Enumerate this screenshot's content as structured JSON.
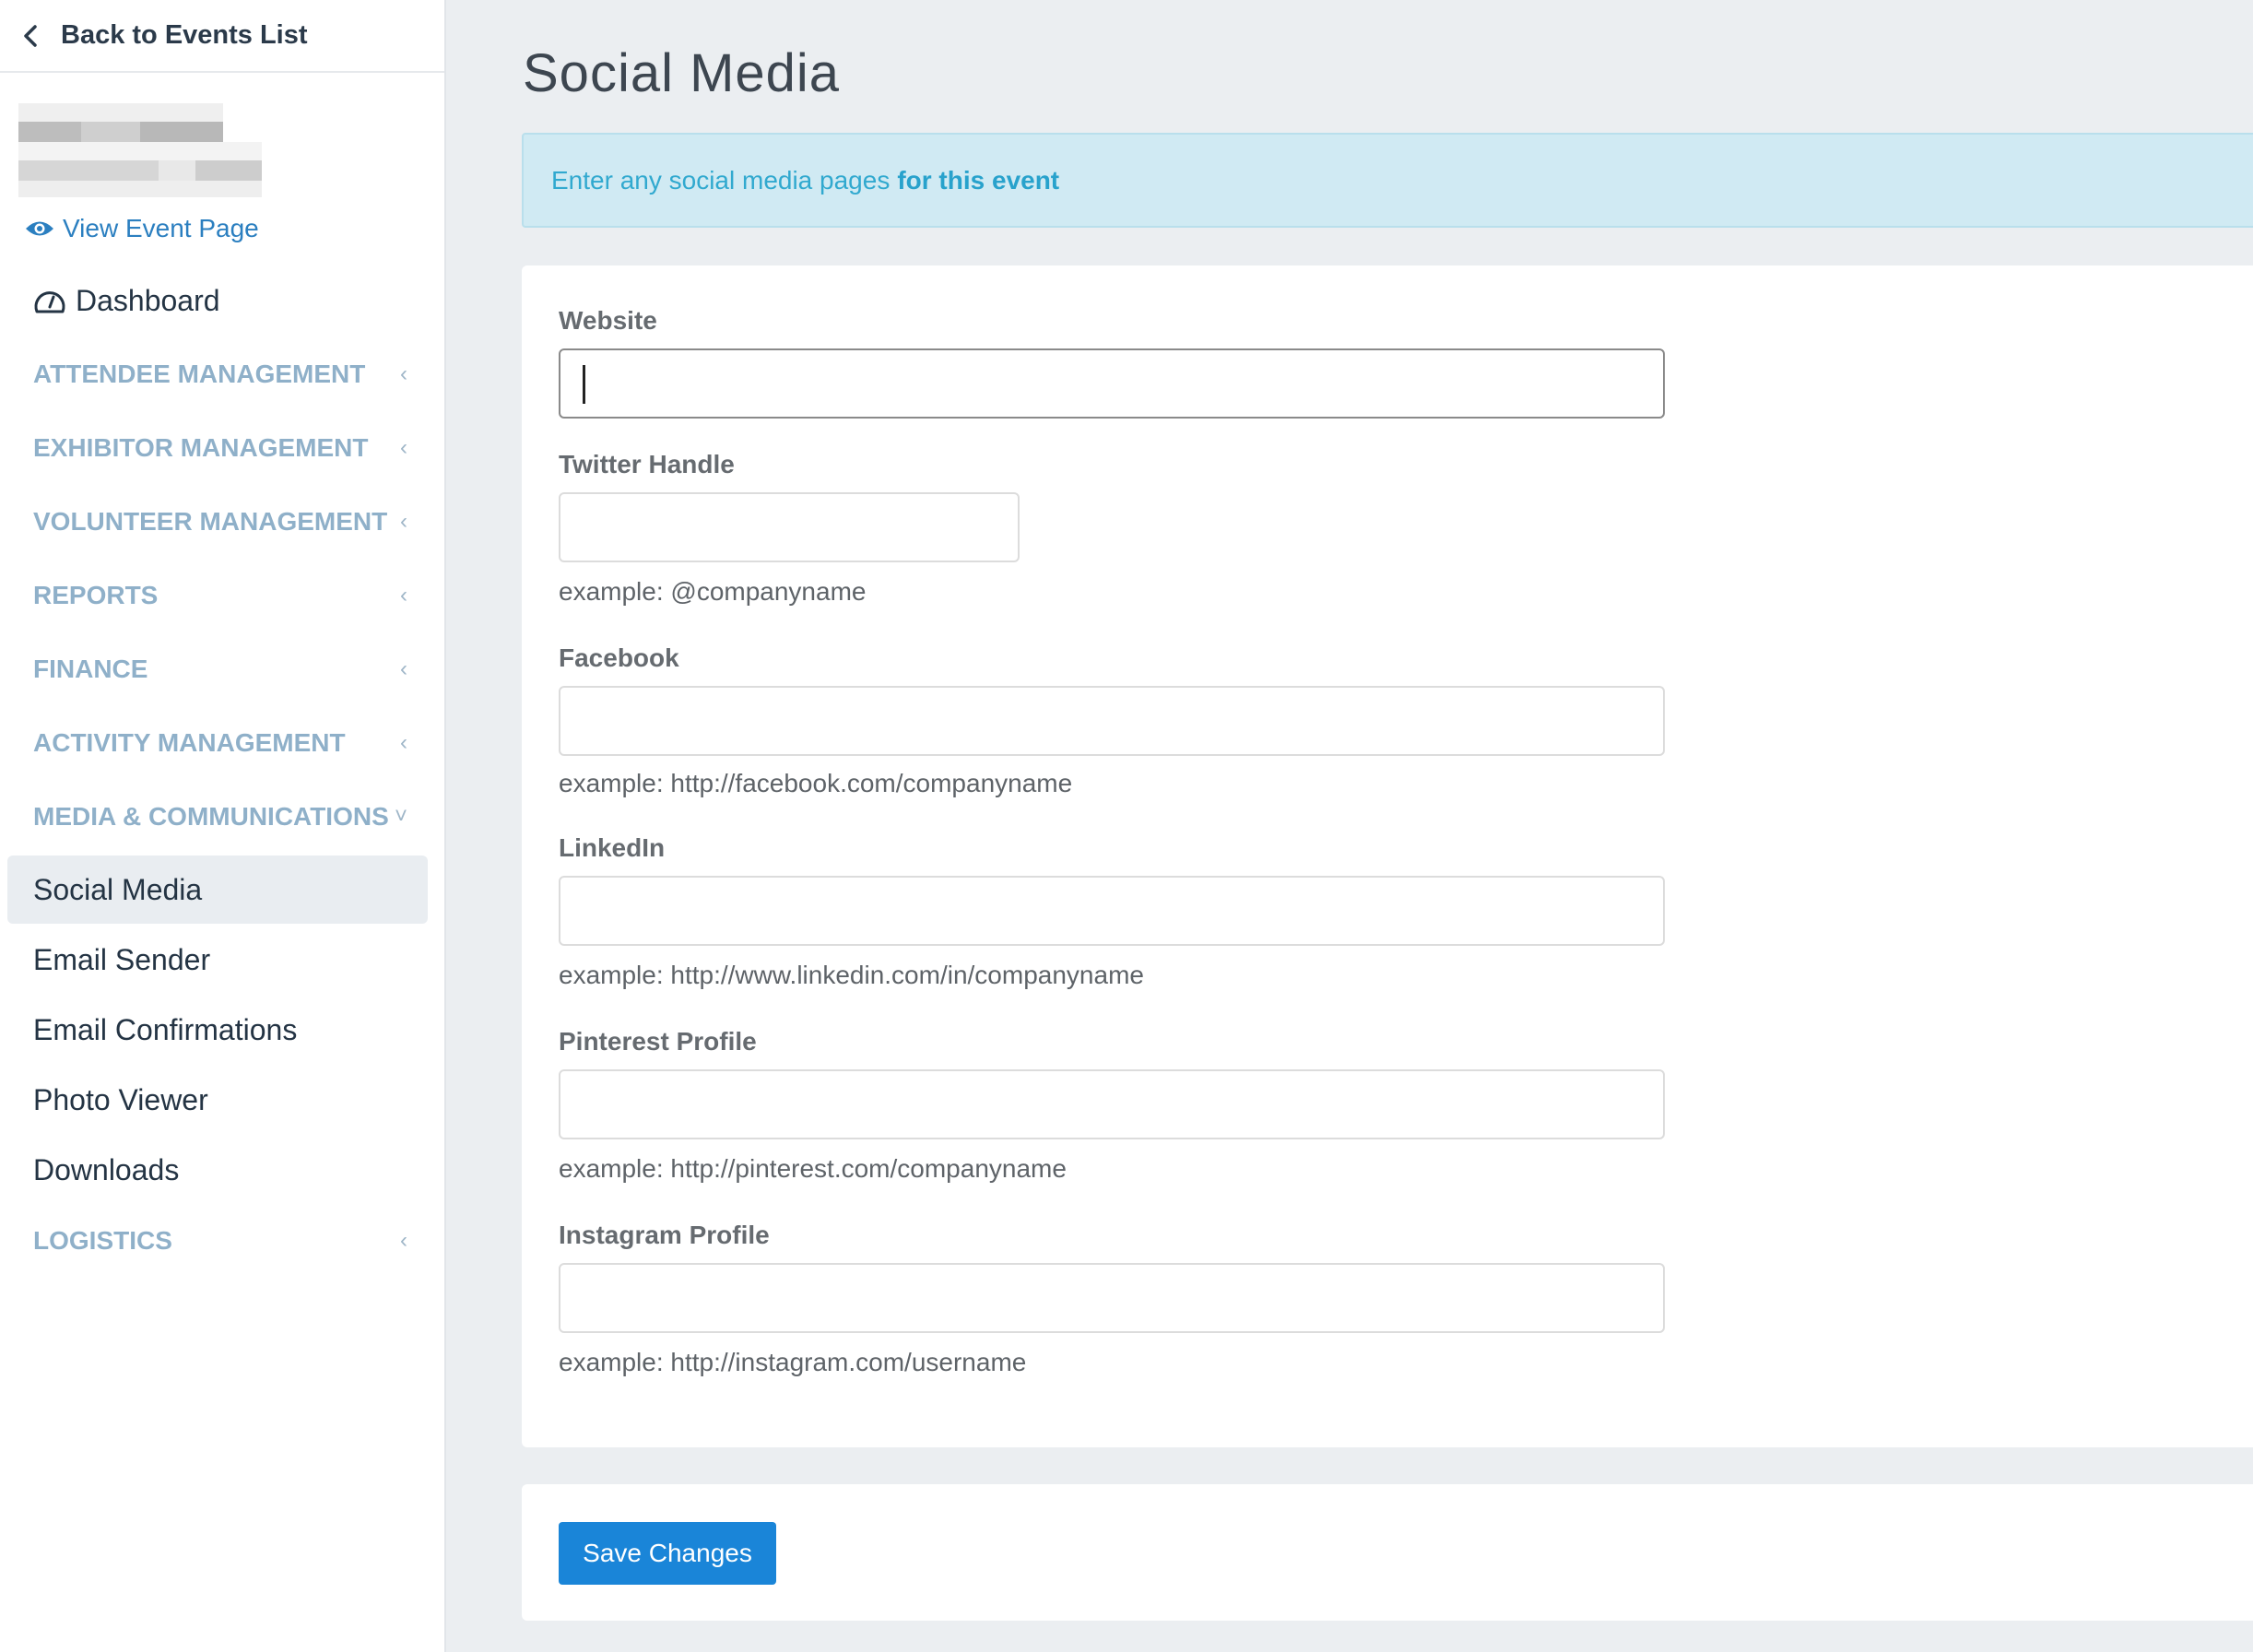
{
  "sidebar": {
    "back_label": "Back to Events List",
    "view_event_label": "View Event Page",
    "dashboard_label": "Dashboard",
    "sections": [
      {
        "label": "ATTENDEE MANAGEMENT",
        "chevron": "‹"
      },
      {
        "label": "EXHIBITOR MANAGEMENT",
        "chevron": "‹"
      },
      {
        "label": "VOLUNTEER MANAGEMENT",
        "chevron": "‹"
      },
      {
        "label": "REPORTS",
        "chevron": "‹"
      },
      {
        "label": "FINANCE",
        "chevron": "‹"
      },
      {
        "label": "ACTIVITY MANAGEMENT",
        "chevron": "‹"
      },
      {
        "label": "MEDIA & COMMUNICATIONS",
        "chevron": "˅"
      }
    ],
    "sub_items": [
      "Social Media",
      "Email Sender",
      "Email Confirmations",
      "Photo Viewer",
      "Downloads"
    ],
    "active_sub_item": "Social Media",
    "logistics": {
      "label": "LOGISTICS",
      "chevron": "‹"
    }
  },
  "main": {
    "title": "Social Media",
    "alert_text": "Enter any social media pages",
    "alert_bold": "for this event",
    "fields": {
      "website": {
        "label": "Website",
        "value": ""
      },
      "twitter": {
        "label": "Twitter Handle",
        "value": "",
        "help": "example: @companyname"
      },
      "facebook": {
        "label": "Facebook",
        "value": "",
        "help": "example: http://facebook.com/companyname"
      },
      "linkedin": {
        "label": "LinkedIn",
        "value": "",
        "help": "example: http://www.linkedin.com/in/companyname"
      },
      "pinterest": {
        "label": "Pinterest Profile",
        "value": "",
        "help": "example: http://pinterest.com/companyname"
      },
      "instagram": {
        "label": "Instagram Profile",
        "value": "",
        "help": "example: http://instagram.com/username"
      }
    },
    "save_label": "Save Changes"
  },
  "colors": {
    "accent": "#1a85d8",
    "section_text": "#8fb0c9",
    "alert_bg": "#d0eaf3",
    "alert_text": "#31a9cf"
  }
}
